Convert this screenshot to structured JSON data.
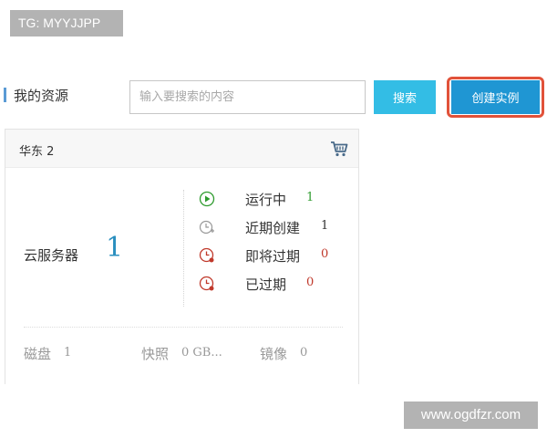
{
  "watermarks": {
    "top": "TG: MYYJJPP",
    "bottom": "www.ogdfzr.com"
  },
  "header": {
    "title": "我的资源",
    "search_placeholder": "输入要搜索的内容",
    "search_button": "搜索",
    "create_button": "创建实例"
  },
  "colors": {
    "accent": "#1f96d3",
    "search_button": "#33bde5",
    "highlight_ring": "#e1523a",
    "running": "#2e9b2e",
    "expired": "#c0392b",
    "count": "#2a8fbf"
  },
  "card": {
    "region": "华东 2",
    "cart_icon": "shopping-cart-icon",
    "service": {
      "name": "云服务器",
      "count": "1"
    },
    "statuses": [
      {
        "icon": "play-circle-icon",
        "label": "运行中",
        "count": "1"
      },
      {
        "icon": "clock-plus-icon",
        "label": "近期创建",
        "count": "1"
      },
      {
        "icon": "clock-alert-icon",
        "label": "即将过期",
        "count": "0"
      },
      {
        "icon": "clock-expired-icon",
        "label": "已过期",
        "count": "0"
      }
    ],
    "bottom": [
      {
        "label": "磁盘",
        "value": "1"
      },
      {
        "label": "快照",
        "value": "0 GB..."
      },
      {
        "label": "镜像",
        "value": "0"
      }
    ]
  }
}
